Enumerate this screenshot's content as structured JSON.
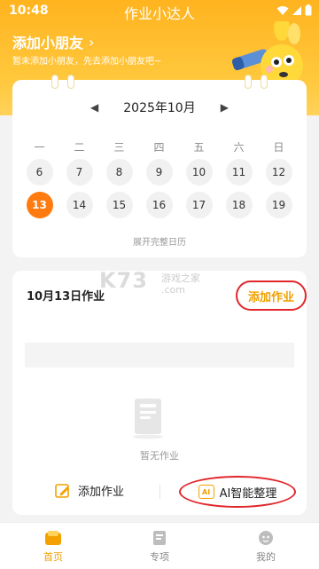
{
  "status_bar": {
    "time": "10:48",
    "app_title": "作业小达人"
  },
  "header": {
    "add_kid_label": "添加小朋友",
    "add_kid_chevron": "›",
    "add_kid_subtitle": "暂未添加小朋友，先去添加小朋友吧~"
  },
  "calendar": {
    "month_label": "2025年10月",
    "prev_icon": "◀",
    "next_icon": "▶",
    "weekdays": [
      "一",
      "二",
      "三",
      "四",
      "五",
      "六",
      "日"
    ],
    "week1": [
      "6",
      "7",
      "8",
      "9",
      "10",
      "11",
      "12"
    ],
    "week2": [
      "13",
      "14",
      "15",
      "16",
      "17",
      "18",
      "19"
    ],
    "selected_day": "13",
    "expand_label": "展开完整日历"
  },
  "homework": {
    "title": "10月13日作业",
    "add_top_label": "添加作业",
    "empty_label": "暂无作业",
    "add_bottom_label": "添加作业",
    "ai_badge": "AI",
    "ai_label": "AI智能整理"
  },
  "watermark": {
    "main": "K73",
    "line1": "游戏之家",
    "line2": ".com"
  },
  "tabs": [
    {
      "label": "首页",
      "icon": "home-icon",
      "active": true
    },
    {
      "label": "专项",
      "icon": "book-icon",
      "active": false
    },
    {
      "label": "我的",
      "icon": "profile-icon",
      "active": false
    }
  ],
  "colors": {
    "brand": "#ffb31f",
    "accent": "#ff7a0f",
    "highlight": "#f0a000",
    "annotation": "#e0262b"
  }
}
